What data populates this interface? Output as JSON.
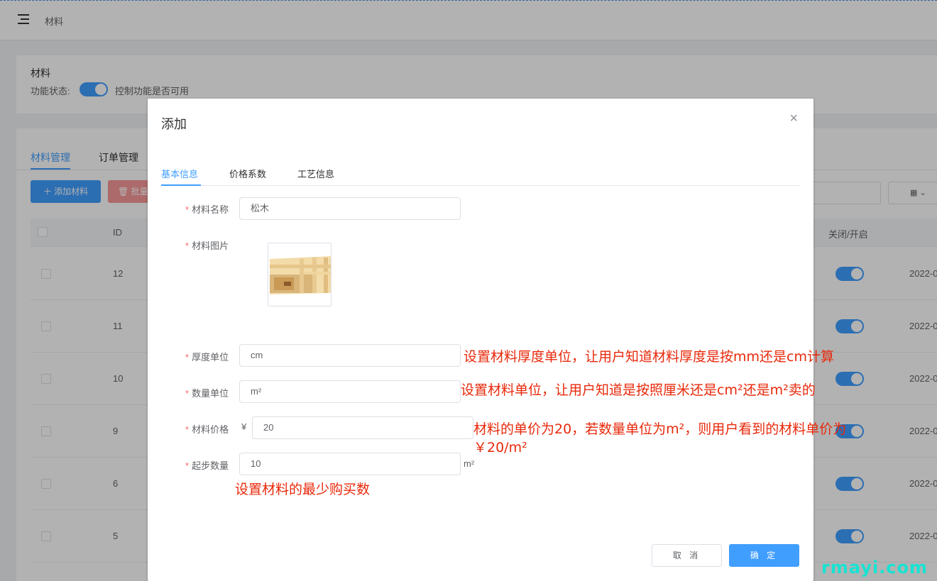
{
  "header": {
    "breadcrumb": "材料"
  },
  "feature": {
    "title": "材料",
    "status_label": "功能状态:",
    "description": "控制功能是否可用",
    "enabled": true
  },
  "main_tabs": [
    "材料管理",
    "订单管理"
  ],
  "toolbar": {
    "add_label": "添加材料",
    "batch_label": "批量"
  },
  "table": {
    "headers": {
      "id": "ID",
      "switch": "关闭/开启"
    },
    "rows": [
      {
        "id": "12",
        "date": "2022-0",
        "enabled": true
      },
      {
        "id": "11",
        "date": "2022-0",
        "enabled": true
      },
      {
        "id": "10",
        "date": "2022-0",
        "enabled": true
      },
      {
        "id": "9",
        "date": "2022-0",
        "enabled": true
      },
      {
        "id": "6",
        "date": "2022-0",
        "enabled": true
      },
      {
        "id": "5",
        "date": "2022-0",
        "enabled": true
      }
    ]
  },
  "dialog": {
    "title": "添加",
    "close": "×",
    "tabs": [
      "基本信息",
      "价格系数",
      "工艺信息"
    ],
    "required_mark": "*",
    "fields": {
      "name": {
        "label": "材料名称",
        "value": "松木"
      },
      "image": {
        "label": "材料图片"
      },
      "thickness_unit": {
        "label": "厚度单位",
        "value": "cm"
      },
      "quantity_unit": {
        "label": "数量单位",
        "value": "m²"
      },
      "price": {
        "label": "材料价格",
        "prefix": "¥",
        "value": "20"
      },
      "min_qty": {
        "label": "起步数量",
        "value": "10",
        "suffix": "m²"
      }
    },
    "cancel_label": "取 消",
    "ok_label": "确 定"
  },
  "annotations": {
    "thickness": "设置材料厚度单位，让用户知道材料厚度是按mm还是cm计算",
    "quantity": "设置材料单位，让用户知道是按照厘米还是cm²还是m²卖的",
    "price": "材料的单价为20，若数量单位为m²，则用户看到的材料单价为￥20/m²",
    "min_qty": "设置材料的最少购买数"
  },
  "watermark": "rmayi.com",
  "colors": {
    "primary": "#409eff",
    "danger": "#f56c6c",
    "annotation": "#e8290b",
    "watermark": "#17e3d3"
  }
}
